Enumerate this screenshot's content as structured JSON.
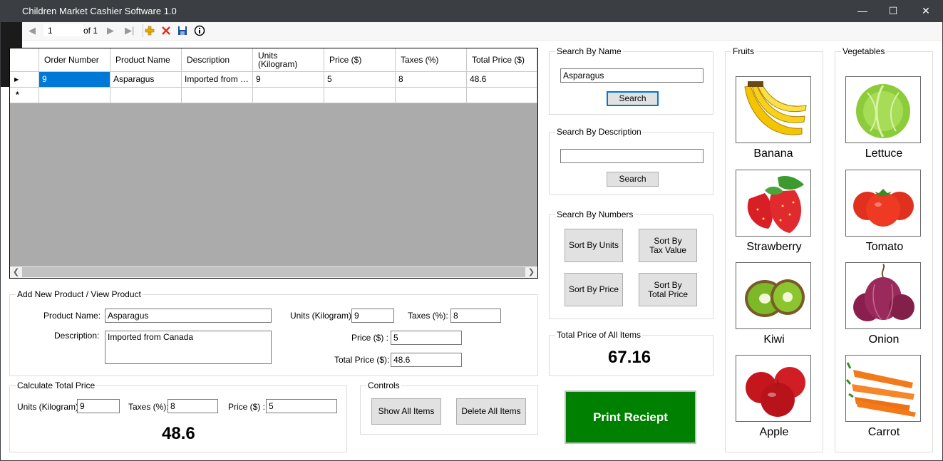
{
  "window": {
    "title": "Children Market Cashier Software 1.0",
    "minimize": "—",
    "maximize": "☐",
    "close": "✕"
  },
  "navigator": {
    "position": "1",
    "count": "of 1"
  },
  "grid": {
    "columns": [
      "Order Number",
      "Product Name",
      "Description",
      "Units (Kilogram)",
      "Price ($)",
      "Taxes (%)",
      "Total Price ($)"
    ],
    "rows": [
      [
        "9",
        "Asparagus",
        "Imported from Ca...",
        "9",
        "5",
        "8",
        "48.6"
      ]
    ],
    "new_row_marker": "*"
  },
  "add_product": {
    "title": "Add New Product / View Product",
    "name_label": "Product Name:",
    "name_value": "Asparagus",
    "description_label": "Description:",
    "description_value": "Imported from Canada",
    "units_label": "Units (Kilogram):",
    "units_value": "9",
    "taxes_label": "Taxes (%):",
    "taxes_value": "8",
    "price_label": "Price ($) :",
    "price_value": "5",
    "total_label": "Total Price ($):",
    "total_value": "48.6"
  },
  "calculate": {
    "title": "Calculate Total Price",
    "units_label": "Units (Kilogram):",
    "units_value": "9",
    "taxes_label": "Taxes (%):",
    "taxes_value": "8",
    "price_label": "Price ($) :",
    "price_value": "5",
    "result": "48.6"
  },
  "controls": {
    "title": "Controls",
    "show_all": "Show All Items",
    "delete_all": "Delete All Items"
  },
  "search_name": {
    "title": "Search By Name",
    "value": "Asparagus",
    "button": "Search"
  },
  "search_description": {
    "title": "Search By Description",
    "value": "",
    "button": "Search"
  },
  "search_numbers": {
    "title": "Search By Numbers",
    "sort_units": "Sort By Units",
    "sort_tax": "Sort By Tax Value",
    "sort_price": "Sort By Price",
    "sort_total": "Sort By Total Price"
  },
  "total_all": {
    "title": "Total Price of All Items",
    "value": "67.16"
  },
  "print_button": "Print Reciept",
  "fruits": {
    "title": "Fruits",
    "items": [
      "Banana",
      "Strawberry",
      "Kiwi",
      "Apple"
    ]
  },
  "vegetables": {
    "title": "Vegetables",
    "items": [
      "Lettuce",
      "Tomato",
      "Onion",
      "Carrot"
    ]
  },
  "colors": {
    "titlebar": "#3b3e42",
    "selection": "#0078d7",
    "print_button": "#008000",
    "grid_background": "#ababab"
  },
  "icons": {
    "nav_first": "first-record-icon",
    "nav_prev": "previous-record-icon",
    "nav_next": "next-record-icon",
    "nav_last": "last-record-icon",
    "add": "add-icon",
    "delete": "delete-icon",
    "save": "save-icon",
    "info": "info-icon"
  }
}
